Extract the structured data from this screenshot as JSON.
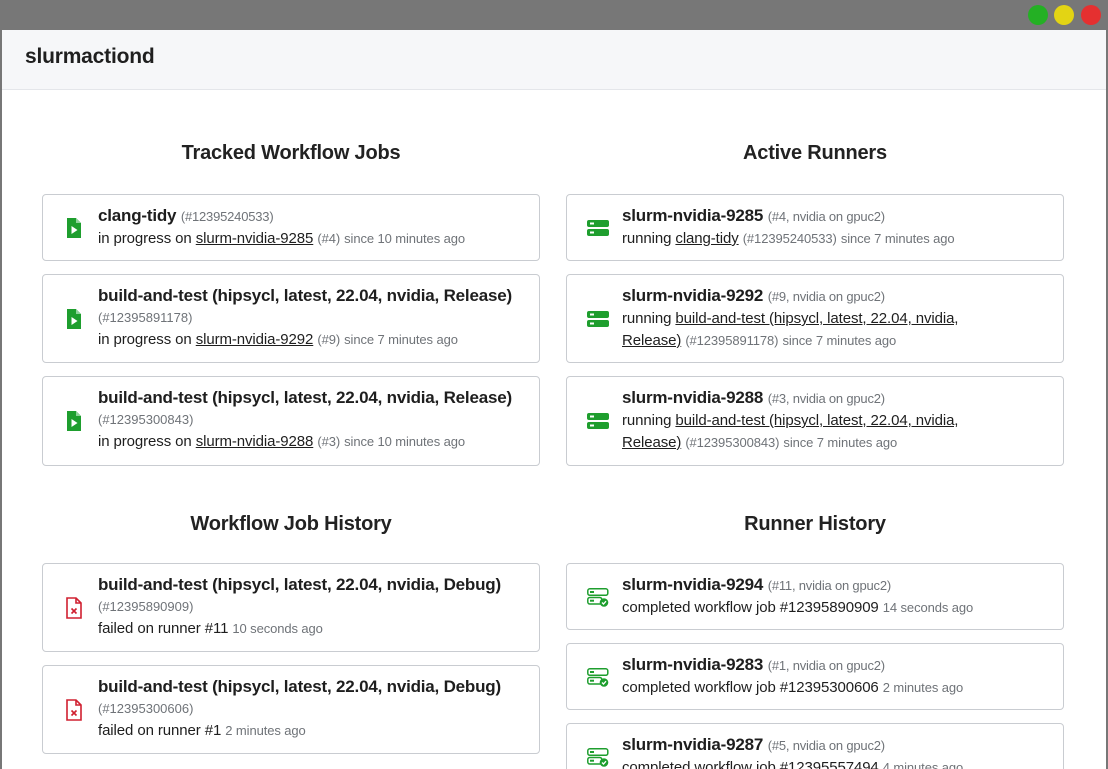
{
  "window": {
    "controls": [
      "green",
      "yellow",
      "red"
    ]
  },
  "app": {
    "title": "slurmactiond"
  },
  "tracked": {
    "title": "Tracked Workflow Jobs",
    "jobs": [
      {
        "name": "clang-tidy",
        "id": "(#12395240533)",
        "status": "in progress on",
        "runner": "slurm-nvidia-9285",
        "runner_num": "(#4)",
        "time": "since 10 minutes ago"
      },
      {
        "name": "build-and-test (hipsycl, latest, 22.04, nvidia, Release)",
        "id": "(#12395891178)",
        "status": "in progress on",
        "runner": "slurm-nvidia-9292",
        "runner_num": "(#9)",
        "time": "since 7 minutes ago"
      },
      {
        "name": "build-and-test (hipsycl, latest, 22.04, nvidia, Release)",
        "id": "(#12395300843)",
        "status": "in progress on",
        "runner": "slurm-nvidia-9288",
        "runner_num": "(#3)",
        "time": "since 10 minutes ago"
      }
    ]
  },
  "active": {
    "title": "Active Runners",
    "runners": [
      {
        "name": "slurm-nvidia-9285",
        "meta": "(#4, nvidia on gpuc2)",
        "status": "running",
        "job": "clang-tidy",
        "job_id": "(#12395240533)",
        "time": "since 7 minutes ago"
      },
      {
        "name": "slurm-nvidia-9292",
        "meta": "(#9, nvidia on gpuc2)",
        "status": "running",
        "job_a": "build-and-test (hipsycl, latest, 22.04, nvidia,",
        "job_b": "Release)",
        "job_id": "(#12395891178)",
        "time": "since 7 minutes ago"
      },
      {
        "name": "slurm-nvidia-9288",
        "meta": "(#3, nvidia on gpuc2)",
        "status": "running",
        "job_a": "build-and-test (hipsycl, latest, 22.04, nvidia,",
        "job_b": "Release)",
        "job_id": "(#12395300843)",
        "time": "since 7 minutes ago"
      }
    ]
  },
  "history": {
    "title": "Workflow Job History",
    "jobs": [
      {
        "name": "build-and-test (hipsycl, latest, 22.04, nvidia, Debug)",
        "id": "(#12395890909)",
        "status": "failed on runner #11",
        "time": "10 seconds ago"
      },
      {
        "name": "build-and-test (hipsycl, latest, 22.04, nvidia, Debug)",
        "id": "(#12395300606)",
        "status": "failed on runner #1",
        "time": "2 minutes ago"
      }
    ]
  },
  "runner_history": {
    "title": "Runner History",
    "runners": [
      {
        "name": "slurm-nvidia-9294",
        "meta": "(#11, nvidia on gpuc2)",
        "status": "completed workflow job #12395890909",
        "time": "14 seconds ago"
      },
      {
        "name": "slurm-nvidia-9283",
        "meta": "(#1, nvidia on gpuc2)",
        "status": "completed workflow job #12395300606",
        "time": "2 minutes ago"
      },
      {
        "name": "slurm-nvidia-9287",
        "meta": "(#5, nvidia on gpuc2)",
        "status": "completed workflow job #12395557494",
        "time": "4 minutes ago"
      }
    ]
  },
  "colors": {
    "success": "#1e9e2e",
    "danger": "#d02030",
    "border": "#c9ccd1"
  }
}
